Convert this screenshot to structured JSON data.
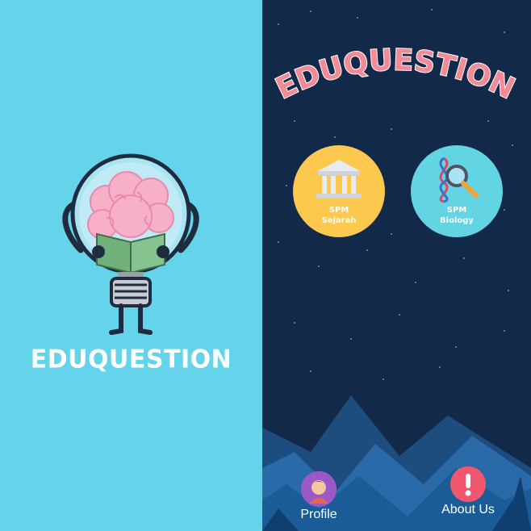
{
  "splash": {
    "title": "EDUQUESTION",
    "background_color": "#65d3ea",
    "mascot": "lightbulb-brain-reading-book-icon"
  },
  "home": {
    "title": "EDUQUESTION",
    "title_color": "#f28b95",
    "background_color": "#12294a",
    "subjects": [
      {
        "line1": "SPM",
        "line2": "Sejarah",
        "icon": "museum-icon",
        "color": "#fdc84e"
      },
      {
        "line1": "SPM",
        "line2": "Biology",
        "icon": "dna-magnifier-icon",
        "color": "#62d4e3"
      }
    ],
    "nav": [
      {
        "label": "Profile",
        "icon": "user-avatar-icon",
        "color": "#9b59c8"
      },
      {
        "label": "About Us",
        "icon": "exclamation-icon",
        "color": "#f0566e"
      }
    ]
  }
}
